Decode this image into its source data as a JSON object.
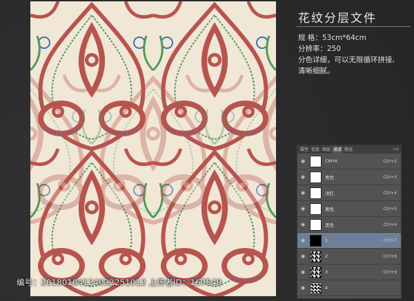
{
  "heading": "花纹分层文件",
  "specs": {
    "size_line": "规 格：53cm*64cm",
    "resolution_line": "分辨率：250",
    "desc1": "分色详细，可以无限循环拼接,",
    "desc2": "清晰细腻。"
  },
  "panel": {
    "tabs": [
      "属性",
      "信息",
      "图层",
      "通道",
      "路径"
    ],
    "active_tab": "通道",
    "channels": [
      {
        "name": "CMYK",
        "shortcut": "Ctrl+2",
        "thumb": "white"
      },
      {
        "name": "青色",
        "shortcut": "Ctrl+3",
        "thumb": "white"
      },
      {
        "name": "洋红",
        "shortcut": "Ctrl+4",
        "thumb": "white"
      },
      {
        "name": "黄色",
        "shortcut": "Ctrl+5",
        "thumb": "white"
      },
      {
        "name": "黑色",
        "shortcut": "Ctrl+6",
        "thumb": "white"
      },
      {
        "name": "1",
        "shortcut": "Ctrl+7",
        "thumb": "black",
        "selected": true
      },
      {
        "name": "2",
        "shortcut": "Ctrl+8",
        "thumb": "noise"
      },
      {
        "name": "3",
        "shortcut": "Ctrl+9",
        "thumb": "noise"
      },
      {
        "name": "4",
        "shortcut": "",
        "thumb": "noise2"
      }
    ]
  },
  "footer": "编号：20180104124032251012 上传者ID：167549",
  "colors": {
    "pattern_red": "#b8544e",
    "pattern_cream": "#f1e7d6",
    "pattern_green": "#4f9a5a",
    "pattern_blue": "#3f6fb0"
  }
}
